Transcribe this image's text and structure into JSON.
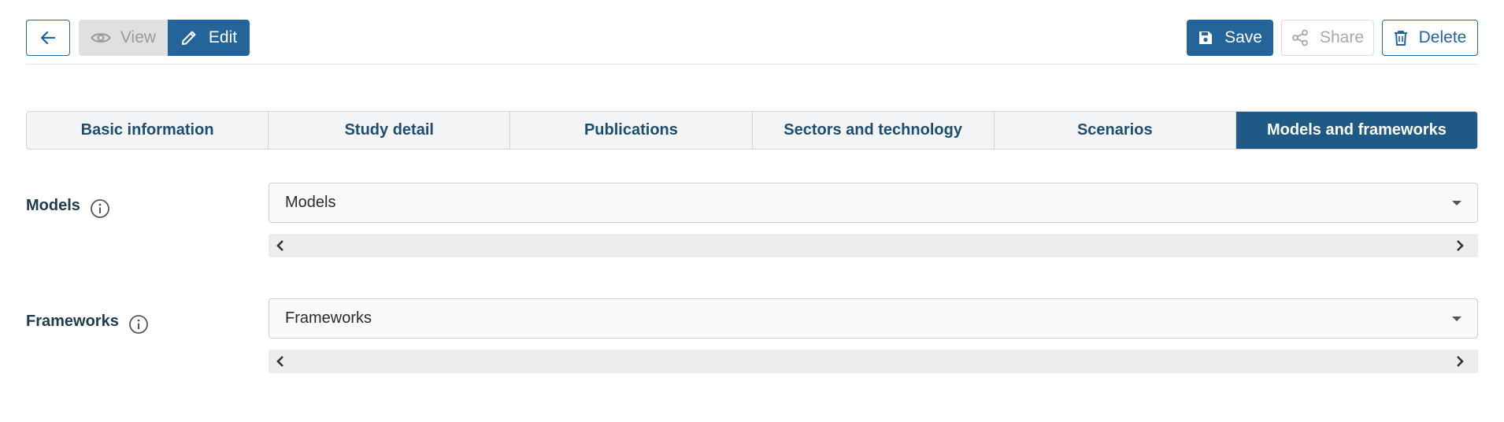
{
  "toolbar": {
    "view_label": "View",
    "edit_label": "Edit",
    "save_label": "Save",
    "share_label": "Share",
    "delete_label": "Delete"
  },
  "tabs": [
    {
      "label": "Basic information"
    },
    {
      "label": "Study detail"
    },
    {
      "label": "Publications"
    },
    {
      "label": "Sectors and technology"
    },
    {
      "label": "Scenarios"
    },
    {
      "label": "Models and frameworks",
      "active": true
    }
  ],
  "models": {
    "label": "Models",
    "placeholder": "Models"
  },
  "frameworks": {
    "label": "Frameworks",
    "placeholder": "Frameworks"
  },
  "colors": {
    "primary": "#23649a",
    "active_tab": "#1e5a85",
    "tab_text": "#1f4d6e"
  }
}
